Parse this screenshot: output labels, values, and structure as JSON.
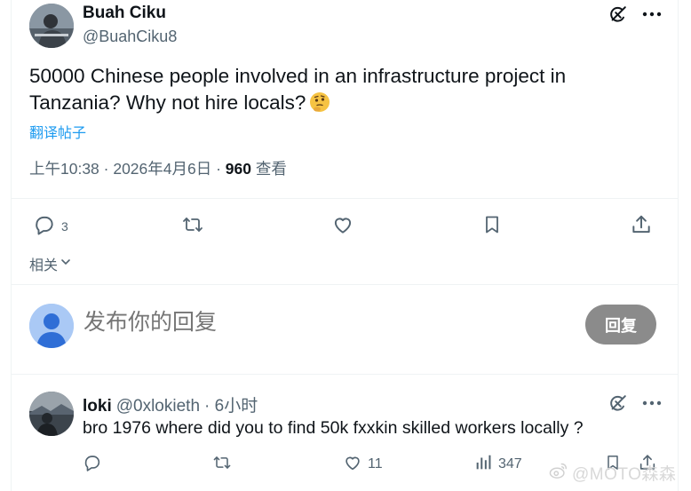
{
  "post": {
    "author_name": "Buah Ciku",
    "author_handle": "@BuahCiku8",
    "text": "50000 Chinese people involved in an infrastructure project in Tanzania? Why not hire locals?",
    "emoji": "thinking-face-icon",
    "translate_label": "翻译帖子",
    "time": "上午10:38 · 2026年4月6日 · ",
    "views": "960",
    "views_label": " 查看",
    "actions": {
      "replies": "3",
      "retweets": "",
      "likes": "",
      "bookmarks": ""
    }
  },
  "related_label": "相关",
  "composer": {
    "placeholder": "发布你的回复",
    "button_label": "回复"
  },
  "reply": {
    "name": "loki",
    "handle": "@0xlokieth",
    "time": "· 6小时",
    "text": "bro 1976 where did you to find 50k fxxkin skilled workers locally ?",
    "actions": {
      "replies": "",
      "retweets": "",
      "likes": "11",
      "views": "347"
    }
  },
  "watermark": "@MOTO森森",
  "colors": {
    "secondary_text": "#536471",
    "link": "#1d9bf0",
    "reply_button": "#8b8b8b",
    "divider": "#eff3f4"
  }
}
